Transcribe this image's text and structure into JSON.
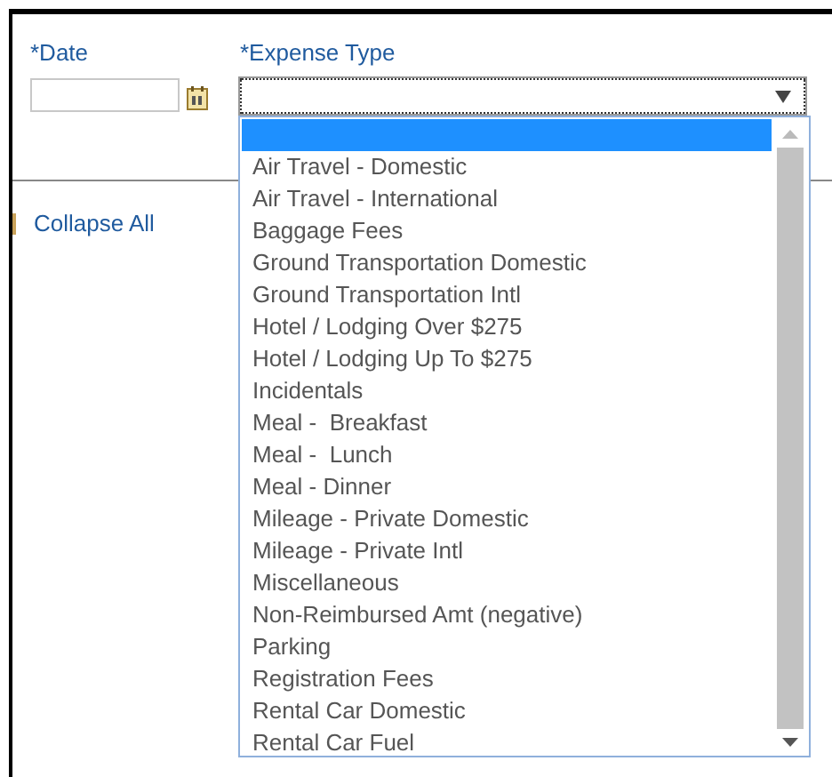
{
  "date_field": {
    "label": "*Date"
  },
  "expense_type_field": {
    "label": "*Expense Type",
    "open": true,
    "options": [
      {
        "selected": true
      },
      {
        "label": "Air Travel - Domestic",
        "selected": false
      },
      {
        "label": "Air Travel - International",
        "selected": false
      },
      {
        "label": "Baggage Fees",
        "selected": false
      },
      {
        "label": "Ground Transportation Domestic",
        "selected": false
      },
      {
        "label": "Ground Transportation Intl",
        "selected": false
      },
      {
        "label": "Hotel / Lodging Over $275",
        "selected": false
      },
      {
        "label": "Hotel / Lodging Up To $275",
        "selected": false
      },
      {
        "label": "Incidentals",
        "selected": false
      },
      {
        "label": "Meal -  Breakfast",
        "selected": false
      },
      {
        "label": "Meal -  Lunch",
        "selected": false
      },
      {
        "label": "Meal - Dinner",
        "selected": false
      },
      {
        "label": "Mileage - Private Domestic",
        "selected": false
      },
      {
        "label": "Mileage - Private Intl",
        "selected": false
      },
      {
        "label": "Miscellaneous",
        "selected": false
      },
      {
        "label": "Non-Reimbursed Amt (negative)",
        "selected": false
      },
      {
        "label": "Parking",
        "selected": false
      },
      {
        "label": "Registration Fees",
        "selected": false
      },
      {
        "label": "Rental Car Domestic",
        "selected": false
      },
      {
        "label": "Rental Car Fuel",
        "selected": false
      }
    ]
  },
  "collapse_link": "Collapse All"
}
